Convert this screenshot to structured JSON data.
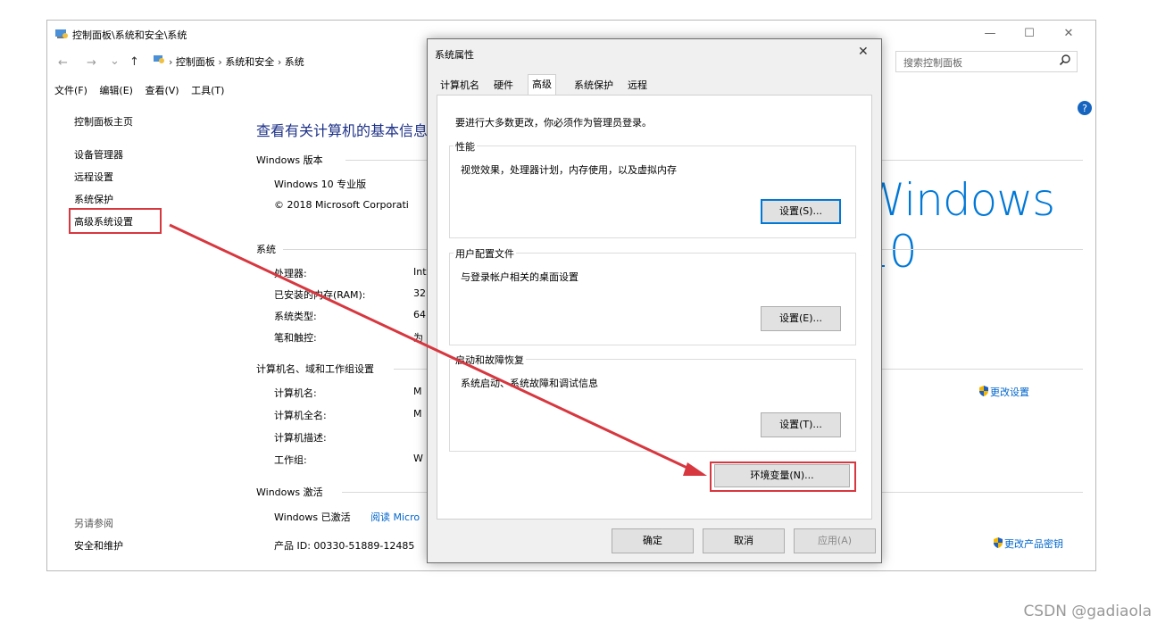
{
  "window": {
    "title": "控制面板\\系统和安全\\系统",
    "controls": {
      "minimize": "—",
      "maximize": "☐",
      "close": "✕"
    }
  },
  "address": {
    "nav_back": "←",
    "nav_forward": "→",
    "nav_dropdown": "⌄",
    "nav_up": "↑",
    "crumbs": [
      "控制面板",
      "系统和安全",
      "系统"
    ],
    "search_placeholder": "搜索控制面板"
  },
  "menu": [
    "文件(F)",
    "编辑(E)",
    "查看(V)",
    "工具(T)"
  ],
  "sidebar": {
    "home": "控制面板主页",
    "items": [
      "设备管理器",
      "远程设置",
      "系统保护",
      "高级系统设置"
    ],
    "see_also_title": "另请参阅",
    "see_also": [
      "安全和维护"
    ]
  },
  "main": {
    "heading": "查看有关计算机的基本信息",
    "edition_title": "Windows 版本",
    "edition": "Windows 10 专业版",
    "copyright": "© 2018 Microsoft Corporati",
    "logo_text": "Windows 10",
    "system_title": "系统",
    "system_rows": [
      {
        "label": "处理器:",
        "value": "Int"
      },
      {
        "label": "已安装的内存(RAM):",
        "value": "32"
      },
      {
        "label": "系统类型:",
        "value": "64"
      },
      {
        "label": "笔和触控:",
        "value": "为"
      }
    ],
    "computer_title": "计算机名、域和工作组设置",
    "computer_rows": [
      {
        "label": "计算机名:",
        "value": "M"
      },
      {
        "label": "计算机全名:",
        "value": "M"
      },
      {
        "label": "计算机描述:",
        "value": ""
      },
      {
        "label": "工作组:",
        "value": "W"
      }
    ],
    "change_settings": "更改设置",
    "activation_title": "Windows 激活",
    "activation_status": "Windows 已激活",
    "activation_link": "阅读 Micro",
    "product_id": "产品 ID: 00330-51889-12485",
    "change_key": "更改产品密钥"
  },
  "dialog": {
    "title": "系统属性",
    "close": "✕",
    "tabs": [
      "计算机名",
      "硬件",
      "高级",
      "系统保护",
      "远程"
    ],
    "selected_tab": "高级",
    "admin_note": "要进行大多数更改，你必须作为管理员登录。",
    "performance": {
      "label": "性能",
      "desc": "视觉效果，处理器计划，内存使用，以及虚拟内存",
      "button": "设置(S)..."
    },
    "profiles": {
      "label": "用户配置文件",
      "desc": "与登录帐户相关的桌面设置",
      "button": "设置(E)..."
    },
    "startup": {
      "label": "启动和故障恢复",
      "desc": "系统启动、系统故障和调试信息",
      "button": "设置(T)..."
    },
    "env_button": "环境变量(N)...",
    "ok": "确定",
    "cancel": "取消",
    "apply": "应用(A)"
  },
  "watermark": "CSDN @gadiaola",
  "colors": {
    "accent": "#0078d7",
    "highlight": "#d7373f",
    "link": "#0066cc"
  }
}
